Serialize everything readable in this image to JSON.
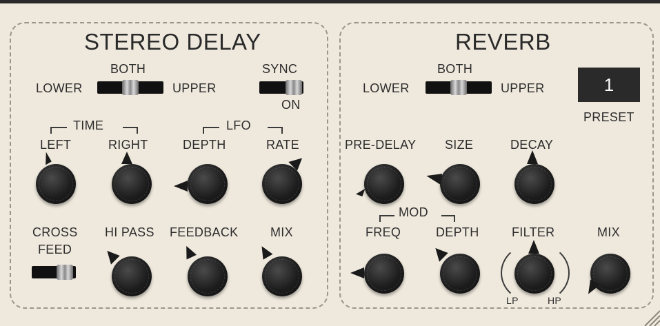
{
  "delay": {
    "title": "STEREO DELAY",
    "mode": {
      "lower": "LOWER",
      "both": "BOTH",
      "upper": "UPPER"
    },
    "sync": {
      "label": "SYNC",
      "state": "ON"
    },
    "time_group": "TIME",
    "lfo_group": "LFO",
    "knobs_row1": [
      "LEFT",
      "RIGHT",
      "DEPTH",
      "RATE"
    ],
    "cross_feed": {
      "line1": "CROSS",
      "line2": "FEED"
    },
    "knobs_row2": [
      "HI PASS",
      "FEEDBACK",
      "MIX"
    ]
  },
  "reverb": {
    "title": "REVERB",
    "mode": {
      "lower": "LOWER",
      "both": "BOTH",
      "upper": "UPPER"
    },
    "preset": {
      "value": "1",
      "label": "PRESET"
    },
    "knobs_row1": [
      "PRE-DELAY",
      "SIZE",
      "DECAY"
    ],
    "mod_group": "MOD",
    "knobs_row2": [
      "FREQ",
      "DEPTH",
      "FILTER",
      "MIX"
    ],
    "filter_ends": {
      "lp": "LP",
      "hp": "HP"
    }
  },
  "colors": {
    "background": "#efe9dd",
    "knob": "#1d1d1d",
    "display": "#2a2a2a"
  }
}
